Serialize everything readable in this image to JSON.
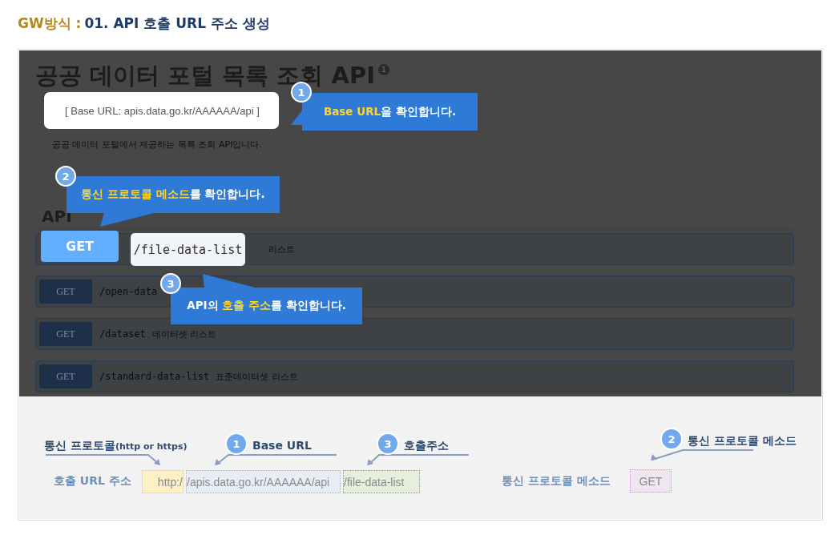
{
  "heading": {
    "prefix": "GW방식 :",
    "title": "01. API 호출 URL 주소 생성"
  },
  "screen": {
    "title": "공공 데이터 포털 목록 조회 API",
    "version_badge": "1",
    "base_url": "[ Base URL: apis.data.go.kr/AAAAAA/api  ]",
    "description": "공공 데이터 포털에서 제공하는 목록 조회 API입니다.",
    "section_title": "API",
    "endpoints": [
      {
        "summary": "리스트"
      },
      {
        "method": "GET",
        "path": "/open-data"
      },
      {
        "method": "GET",
        "path": "/dataset",
        "summary": "데이터셋 리스트"
      },
      {
        "method": "GET",
        "path": "/standard-data-list",
        "summary": "표준데이터셋 리스트"
      }
    ],
    "highlight": {
      "method": "GET",
      "path": "/file-data-list"
    },
    "callouts": [
      {
        "number": "1",
        "parts": [
          {
            "text": "Base URL",
            "highlight": true
          },
          {
            "text": "을 확인합니다.",
            "highlight": false
          }
        ]
      },
      {
        "number": "2",
        "parts": [
          {
            "text": "통신 프로토콜 메소드",
            "highlight": true
          },
          {
            "text": "를 확인합니다.",
            "highlight": false
          }
        ]
      },
      {
        "number": "3",
        "parts": [
          {
            "text": "API의 ",
            "highlight": false
          },
          {
            "text": "호출 주소",
            "highlight": true
          },
          {
            "text": "를 확인합니다.",
            "highlight": false
          }
        ]
      }
    ]
  },
  "diagram": {
    "annotations": [
      {
        "label": "통신 프로토콜",
        "note": "(http or https)"
      },
      {
        "number": "1",
        "label": "Base URL"
      },
      {
        "number": "3",
        "label": "호출주소"
      },
      {
        "number": "2",
        "label": "통신 프로토콜 메소드"
      }
    ],
    "url_label": "호출 URL 주소",
    "url_parts": [
      {
        "kind": "protocol",
        "text": "http:/"
      },
      {
        "kind": "base",
        "text": "/apis.data.go.kr/AAAAAA/api"
      },
      {
        "kind": "path",
        "text": "/file-data-list"
      }
    ],
    "method_label": "통신 프로토콜 메소드",
    "method_value": "GET"
  }
}
